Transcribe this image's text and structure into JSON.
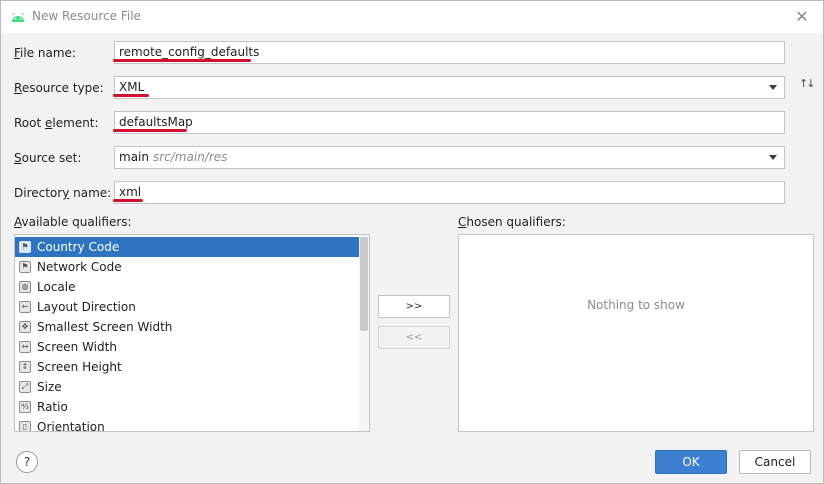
{
  "window": {
    "title": "New Resource File",
    "icon": "android-icon"
  },
  "form": {
    "file_name": {
      "label_first": "F",
      "label_rest": "ile name:",
      "value": "remote_config_defaults"
    },
    "resource_type": {
      "label_first": "R",
      "label_rest": "esource type:",
      "value": "XML"
    },
    "root_element": {
      "label_pre": "Root ",
      "label_first": "e",
      "label_rest": "lement:",
      "value": "defaultsMap"
    },
    "source_set": {
      "label_first": "S",
      "label_rest": "ource set:",
      "value": "main",
      "hint": "src/main/res"
    },
    "directory_name": {
      "label_pre": "Director",
      "label_first": "y",
      "label_rest": " name:",
      "value": "xml"
    }
  },
  "available_qualifiers": {
    "label_first": "A",
    "label_rest": "vailable qualifiers:",
    "items": [
      {
        "label": "Country Code",
        "icon": "country-code-icon",
        "glyph": "⚑",
        "selected": true
      },
      {
        "label": "Network Code",
        "icon": "network-code-icon",
        "glyph": "⚑",
        "selected": false
      },
      {
        "label": "Locale",
        "icon": "globe-icon",
        "glyph": "◍",
        "selected": false
      },
      {
        "label": "Layout Direction",
        "icon": "layout-direction-icon",
        "glyph": "←",
        "selected": false
      },
      {
        "label": "Smallest Screen Width",
        "icon": "smallest-width-icon",
        "glyph": "✥",
        "selected": false
      },
      {
        "label": "Screen Width",
        "icon": "screen-width-icon",
        "glyph": "↔",
        "selected": false
      },
      {
        "label": "Screen Height",
        "icon": "screen-height-icon",
        "glyph": "↕",
        "selected": false
      },
      {
        "label": "Size",
        "icon": "size-icon",
        "glyph": "⤢",
        "selected": false
      },
      {
        "label": "Ratio",
        "icon": "ratio-icon",
        "glyph": "⁴⁄₃",
        "selected": false
      },
      {
        "label": "Orientation",
        "icon": "orientation-icon",
        "glyph": "▯",
        "selected": false
      }
    ]
  },
  "chosen_qualifiers": {
    "label_first": "C",
    "label_rest": "hosen qualifiers:",
    "empty_text": "Nothing to show"
  },
  "buttons": {
    "add": ">>",
    "remove": "<<",
    "help": "?",
    "ok": "OK",
    "cancel": "Cancel"
  },
  "colors": {
    "accent": "#3d7fd0",
    "selection": "#2f74c0",
    "annotation_red": "#d3112e"
  }
}
